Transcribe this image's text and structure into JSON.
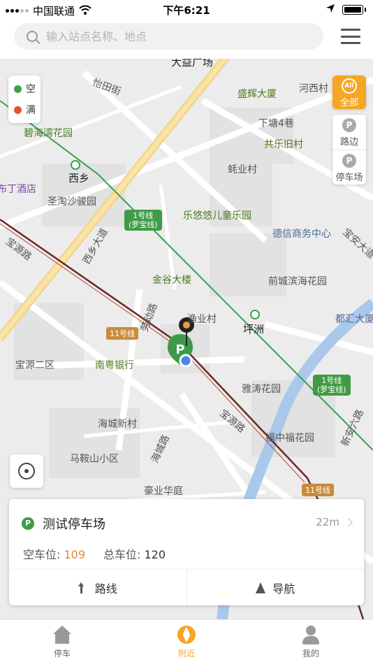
{
  "status_bar": {
    "carrier": "中国联通",
    "time": "下午6:21"
  },
  "search": {
    "placeholder": "输入站点名称、地点"
  },
  "legend": [
    {
      "label": "空",
      "color": "#3aa14a"
    },
    {
      "label": "满",
      "color": "#e0552b"
    }
  ],
  "filters": {
    "all_badge": "All",
    "all_label": "全部",
    "roadside_label": "路边",
    "lot_label": "停车场",
    "p_glyph": "P"
  },
  "map": {
    "places": [
      "大益广场",
      "怡田街",
      "盛辉大厦",
      "河西村",
      "碧海湾花园",
      "下塘4巷",
      "共乐旧村",
      "西乡",
      "蚝业村",
      "布丁酒店",
      "圣淘沙骏园",
      "乐悠悠儿童乐园",
      "德信商务中心",
      "宝源路",
      "西乡大道",
      "宝安大道",
      "金谷大楼",
      "前城滨海花园",
      "劳动路",
      "渔业村",
      "坪洲",
      "都汇大厦",
      "宝源二区",
      "南粤银行",
      "雅涛花园",
      "海城新村",
      "宝源路",
      "福中福花园",
      "新安六路",
      "马鞍山小区",
      "海城路",
      "豪业华庭",
      "花园"
    ],
    "metro_line1": "1号线\n(罗宝线)",
    "metro_line11": "11号线"
  },
  "card": {
    "name": "测试停车场",
    "distance": "22m",
    "free_label": "空车位:",
    "free_value": "109",
    "total_label": "总车位:",
    "total_value": "120",
    "route_label": "路线",
    "nav_label": "导航"
  },
  "tabs": [
    {
      "label": "停车"
    },
    {
      "label": "附近"
    },
    {
      "label": "我的"
    }
  ],
  "colors": {
    "accent": "#f5a623",
    "metro_green": "#3aa14a",
    "metro_brown": "#6b2a24"
  }
}
